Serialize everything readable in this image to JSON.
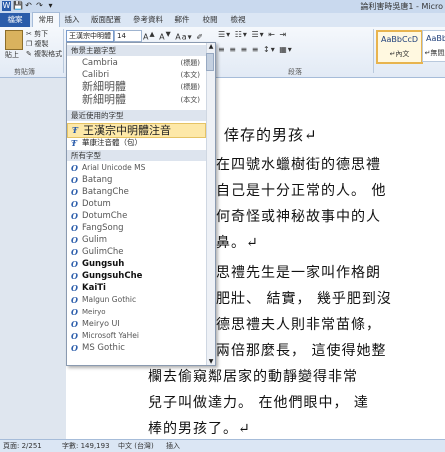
{
  "window": {
    "title": "論利害時吳唐1 - Micro",
    "qat": [
      "W",
      "💾",
      "↶",
      "↷",
      "▾"
    ]
  },
  "tabs": [
    "檔案",
    "常用",
    "插入",
    "版面配置",
    "參考資料",
    "郵件",
    "校閱",
    "檢視"
  ],
  "ribbon": {
    "paste_label": "貼上",
    "cut_label": "剪下",
    "copy_label": "複製",
    "format_painter_label": "複製格式",
    "clipboard_group": "剪貼簿",
    "font_name_value": "王漢宗中明體",
    "font_size_value": "14",
    "paragraph_group": "段落",
    "styles": [
      {
        "sample": "AaBbCcD",
        "name": "↵內文"
      },
      {
        "sample": "AaBbCcD",
        "name": "↵無間距"
      }
    ]
  },
  "font_dropdown": {
    "theme_header": "佈景主題字型",
    "theme_fonts": [
      {
        "name": "Cambria",
        "tag": "(標題)"
      },
      {
        "name": "Calibri",
        "tag": "(本文)"
      },
      {
        "name": "新細明體",
        "tag": "(標題)"
      },
      {
        "name": "新細明體",
        "tag": "(本文)"
      }
    ],
    "recent_header": "最近使用的字型",
    "recent_fonts": [
      {
        "name": "王漢宗中明體注音"
      },
      {
        "name": "華康注音體（包）"
      }
    ],
    "all_header": "所有字型",
    "all_fonts": [
      {
        "name": "Arial Unicode MS"
      },
      {
        "name": "Batang"
      },
      {
        "name": "BatangChe"
      },
      {
        "name": "Dotum"
      },
      {
        "name": "DotumChe"
      },
      {
        "name": "FangSong"
      },
      {
        "name": "Gulim"
      },
      {
        "name": "GulimChe"
      },
      {
        "name": "Gungsuh"
      },
      {
        "name": "GungsuhChe"
      },
      {
        "name": "KaiTi"
      },
      {
        "name": "Malgun Gothic"
      },
      {
        "name": "Meiryo"
      },
      {
        "name": "Meiryo UI"
      },
      {
        "name": "Microsoft YaHei"
      },
      {
        "name": "MS Gothic"
      }
    ]
  },
  "document": {
    "lines": [
      "倖存的男孩↵",
      "在四號水蠟樹街的德思禮",
      "自己是十分正常的人。 他",
      "何奇怪或神秘故事中的人",
      "鼻。↵",
      "思禮先生是一家叫作格朗",
      "肥壯、 結實， 幾乎肥到沒",
      "德思禮夫人則非常苗條，",
      "兩倍那麼長， 這使得她整",
      "欄去偷窺鄰居家的動靜變得非常",
      "兒子叫做達力。 在他們眼中， 達",
      "棒的男孩了。↵"
    ]
  },
  "statusbar": {
    "page": "頁面: 2/251",
    "words": "字數: 149,193",
    "lang": "中文 (台灣)",
    "mode": "插入"
  }
}
